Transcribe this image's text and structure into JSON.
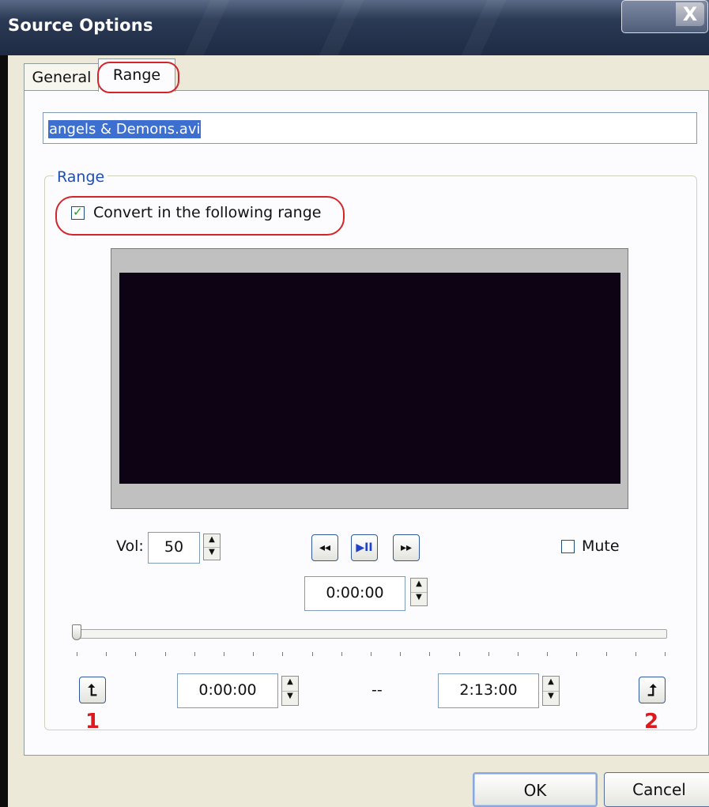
{
  "window": {
    "title": "Source Options",
    "close_label": "X"
  },
  "tabs": [
    {
      "label": "General"
    },
    {
      "label": "Range"
    }
  ],
  "file": {
    "name": "angels & Demons.avi"
  },
  "range_group": {
    "label": "Range",
    "convert_checkbox": {
      "label": "Convert in the following range",
      "checked": true
    }
  },
  "player": {
    "vol_label": "Vol:",
    "vol_value": "50",
    "rewind_icon": "◂◂",
    "play_pause_icon": "▶II",
    "forward_icon": "▸▸",
    "mute_label": "Mute",
    "mute_checked": false,
    "position_value": "0:00:00"
  },
  "range": {
    "start_value": "0:00:00",
    "separator": "--",
    "end_value": "2:13:00",
    "set_start_icon": "arrow-up-left-icon",
    "set_end_icon": "arrow-up-right-icon",
    "annotation_start": "1",
    "annotation_end": "2"
  },
  "buttons": {
    "ok": "OK",
    "cancel": "Cancel"
  },
  "colors": {
    "title_bar": "#2b3a55",
    "highlight": "#d4252a",
    "annotation": "#e0181e",
    "selection": "#3c6fd0"
  }
}
